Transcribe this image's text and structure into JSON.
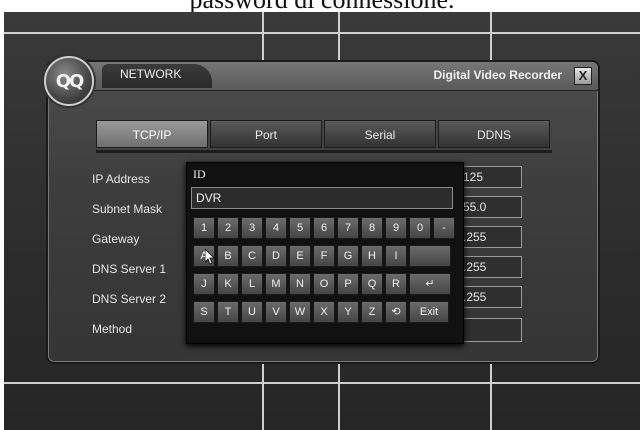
{
  "caption": "password di connessione.",
  "dialog": {
    "section": "NETWORK",
    "app_title": "Digital Video Recorder",
    "close_label": "X",
    "logo_icon": "dvr-logo-icon"
  },
  "tabs": [
    "TCP/IP",
    "Port",
    "Serial",
    "DDNS"
  ],
  "form": {
    "labels": [
      "IP Address",
      "Subnet Mask",
      "Gateway",
      "DNS Server 1",
      "DNS Server 2",
      "Method"
    ],
    "values": [
      "125",
      "55.0",
      ".255",
      ".255",
      ".255"
    ]
  },
  "keyboard": {
    "title": "ID",
    "input_value": "DVR",
    "row1": [
      "1",
      "2",
      "3",
      "4",
      "5",
      "6",
      "7",
      "8",
      "9",
      "0",
      "-"
    ],
    "row2": [
      "A",
      "B",
      "C",
      "D",
      "E",
      "F",
      "G",
      "H",
      "I"
    ],
    "row3": [
      "J",
      "K",
      "L",
      "M",
      "N",
      "O",
      "P",
      "Q",
      "R",
      "↵"
    ],
    "row4": [
      "S",
      "T",
      "U",
      "V",
      "W",
      "X",
      "Y",
      "Z",
      "⟲",
      "Exit"
    ]
  }
}
